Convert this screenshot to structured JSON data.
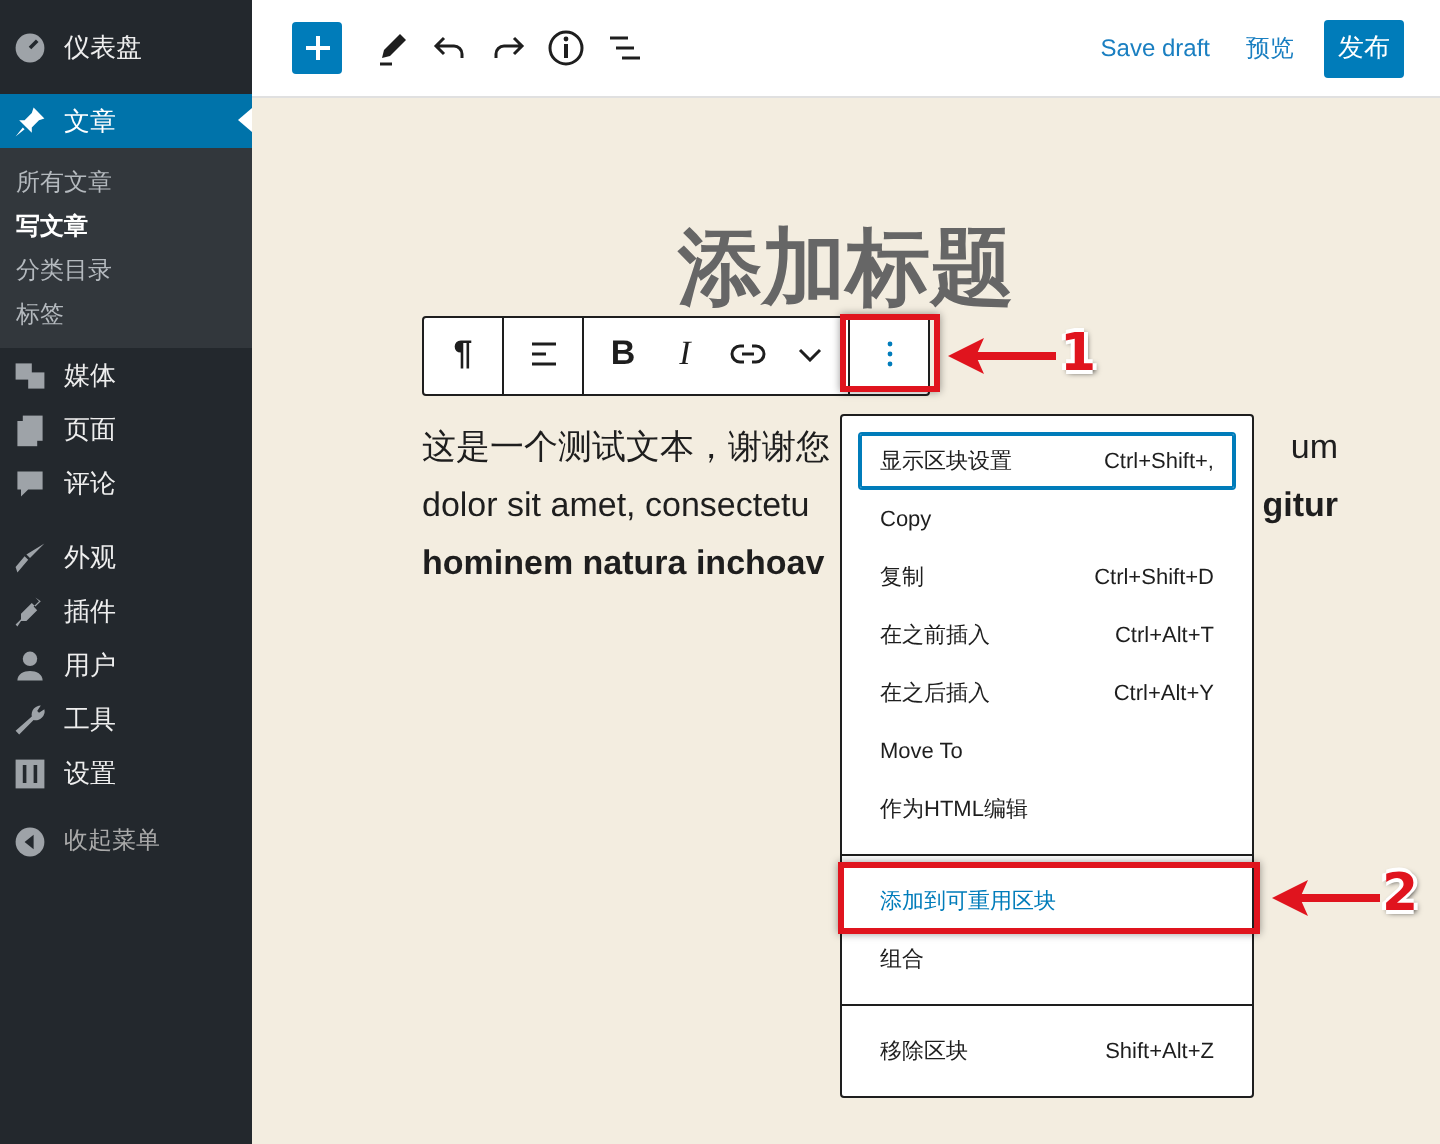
{
  "sidebar": {
    "groups": [
      [
        {
          "label": "仪表盘",
          "selected": false
        }
      ],
      [
        {
          "label": "文章",
          "selected": true,
          "children": [
            {
              "label": "所有文章",
              "selected": false
            },
            {
              "label": "写文章",
              "selected": true
            },
            {
              "label": "分类目录",
              "selected": false
            },
            {
              "label": "标签",
              "selected": false
            }
          ]
        },
        {
          "label": "媒体",
          "selected": false
        },
        {
          "label": "页面",
          "selected": false
        },
        {
          "label": "评论",
          "selected": false
        }
      ],
      [
        {
          "label": "外观",
          "selected": false
        },
        {
          "label": "插件",
          "selected": false
        },
        {
          "label": "用户",
          "selected": false
        },
        {
          "label": "工具",
          "selected": false
        },
        {
          "label": "设置",
          "selected": false
        }
      ]
    ],
    "collapse_label": "收起菜单"
  },
  "header": {
    "save_draft": "Save draft",
    "preview": "预览",
    "publish": "发布"
  },
  "editor": {
    "title_placeholder": "添加标题",
    "block_toolbar": [
      [
        {
          "kind": "paragraph",
          "label": "¶"
        }
      ],
      [
        {
          "kind": "align"
        }
      ],
      [
        {
          "kind": "bold",
          "label": "B"
        },
        {
          "kind": "italic",
          "label": "I"
        },
        {
          "kind": "link"
        },
        {
          "kind": "chevron"
        }
      ],
      [
        {
          "kind": "more"
        }
      ]
    ],
    "paragraph_lines": [
      {
        "left": "这是一个测试文本，谢谢您",
        "left_bold": false,
        "right": "um",
        "right_bold": false
      },
      {
        "left": "dolor sit amet, consectetu",
        "left_bold": false,
        "right": "gitur",
        "right_bold": true
      },
      {
        "left": "hominem natura inchoav",
        "left_bold": true
      }
    ]
  },
  "block_menu": {
    "sections": [
      [
        {
          "label": "显示区块设置",
          "shortcut": "Ctrl+Shift+,",
          "focused": true,
          "hovered": false
        },
        {
          "label": "Copy",
          "focused": false,
          "hovered": false
        },
        {
          "label": "复制",
          "shortcut": "Ctrl+Shift+D",
          "focused": false,
          "hovered": false
        },
        {
          "label": "在之前插入",
          "shortcut": "Ctrl+Alt+T",
          "focused": false,
          "hovered": false
        },
        {
          "label": "在之后插入",
          "shortcut": "Ctrl+Alt+Y",
          "focused": false,
          "hovered": false
        },
        {
          "label": "Move To",
          "focused": false,
          "hovered": false
        },
        {
          "label": "作为HTML编辑",
          "focused": false,
          "hovered": false
        }
      ],
      [
        {
          "label": "添加到可重用区块",
          "focused": false,
          "hovered": true
        },
        {
          "label": "组合",
          "focused": false,
          "hovered": false
        }
      ],
      [
        {
          "label": "移除区块",
          "shortcut": "Shift+Alt+Z",
          "focused": false,
          "hovered": false
        }
      ]
    ]
  },
  "callouts": [
    {
      "number": "1"
    },
    {
      "number": "2"
    }
  ]
}
